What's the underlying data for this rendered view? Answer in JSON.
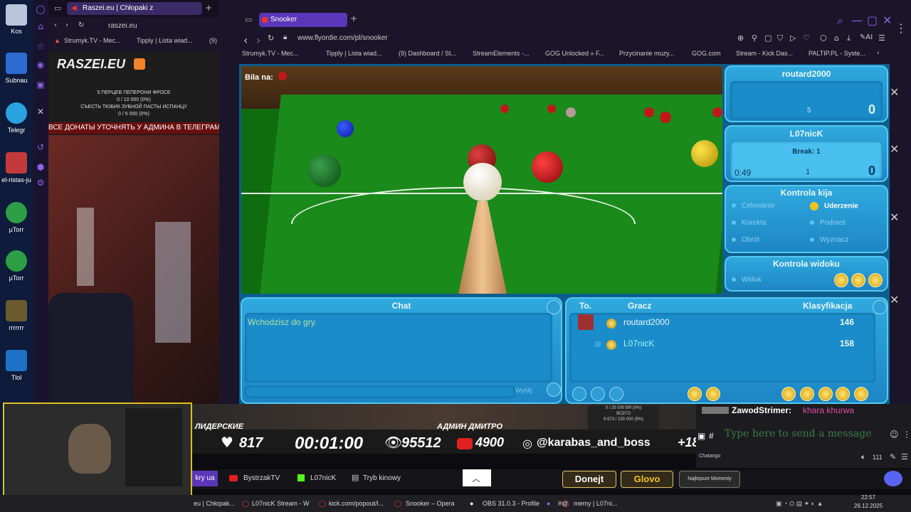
{
  "desktop": {
    "icons": [
      {
        "label": "Kos"
      },
      {
        "label": "Subnau"
      },
      {
        "label": "Telegr"
      },
      {
        "label": "el-ristas-ju"
      },
      {
        "label": "µTorr"
      },
      {
        "label": "µTorr"
      },
      {
        "label": "rrrrrrr"
      },
      {
        "label": "Tlol"
      }
    ]
  },
  "window1": {
    "tab_title": "Raszei.eu | Chłopaki z",
    "address": "raszei.eu",
    "bookmarks": [
      "Strumyk.TV - Mec...",
      "Tipply | Lista wiad...",
      "(9)"
    ],
    "logo": "RASZEI.EU",
    "stream_lines": [
      "5 ПЕРЦЕВ ПЕПЕРОНИ ФРОСЕ",
      "0 / 10 000 (0%)",
      "СЪЕСТЬ ТЮБИК ЗУБНОЙ ПАСТЫ ИСПАНЦУ",
      "0 / 5 000 (0%)",
      "ВСЕ ДОНАТЫ УТОЧНЯТЬ У АДМИНА В ТЕЛЕГРАМ"
    ]
  },
  "window2": {
    "tab_title": "Snooker",
    "address": "www.flyordie.com/pl/snooker",
    "bookmarks": [
      "Strumyk.TV - Mec...",
      "Tipply | Lista wiad...",
      "(9) Dashboard / St...",
      "StreamElements -...",
      "GOG Unlocked » F...",
      "Przycinanie muzy...",
      "GOG.com",
      "Stream - Kick Das...",
      "PALTIP.PL - Syste..."
    ]
  },
  "game": {
    "ball_on_label": "Bila na:",
    "player1": {
      "name": "routard2000",
      "left_val": "5",
      "score": "0"
    },
    "player2": {
      "name": "L07nicK",
      "break_label": "Break: 1",
      "timer": "0:49",
      "left_val": "1",
      "score": "0"
    },
    "cue_control": {
      "title": "Kontrola kija",
      "options": [
        "Celowanie",
        "Uderzenie",
        "Korekta",
        "Podnieś",
        "Obrót",
        "Wyznacz"
      ],
      "selected": "Uderzenie"
    },
    "view_control": {
      "title": "Kontrola widoku",
      "option": "Widok"
    },
    "chat": {
      "title": "Chat",
      "message": "Wchodzisz do gry.",
      "send_label": "Wyślij"
    },
    "players_table": {
      "headers": [
        "To.",
        "Gracz",
        "Klasyfikacja"
      ],
      "rows": [
        {
          "name": "routard2000",
          "rating": "146"
        },
        {
          "name": "L07nicK",
          "rating": "158"
        }
      ]
    }
  },
  "overlay": {
    "left_title": "ЛИДЕРСКИЕ",
    "center_title": "АДМИН ДМИТРО",
    "likes": "817",
    "timer": "00:01:00",
    "viewers": "95512",
    "youtube": "4900",
    "instagram": "@karabas_and_boss",
    "age": "+18",
    "mini_lines": [
      "0 / 25 000 ВЯ (0%)",
      "ВСЕГО",
      "9 873 / 100 000 (9%)"
    ]
  },
  "side_chat": {
    "user": "ZawodStrimer:",
    "message": "khara khurwa",
    "placeholder": "Type here to send a message",
    "volume": "111",
    "hash": "#",
    "chatango": "Chatango"
  },
  "stream_tabs": {
    "items": [
      "kry ua",
      "BystrzakTV",
      "L07nicK",
      "Tryb kinowy"
    ],
    "buttons": [
      "Donejt",
      "Glovo",
      "Najlepsze Momenty"
    ]
  },
  "taskbar": {
    "items": [
      "eu | Chłopak...",
      "L07nicK Stream - W...",
      "kick.com/popout/l...",
      "Snooker – Opera",
      "OBS 31.0.3 - Profile...",
      "#@",
      "memy | L07ni..."
    ],
    "time": "22:57",
    "date": "26.12.2025"
  },
  "colors": {
    "opera_accent": "#5b36b8",
    "game_blue": "#2fa9de",
    "felt": "#1a8a1a",
    "gold": "#f0c419"
  }
}
